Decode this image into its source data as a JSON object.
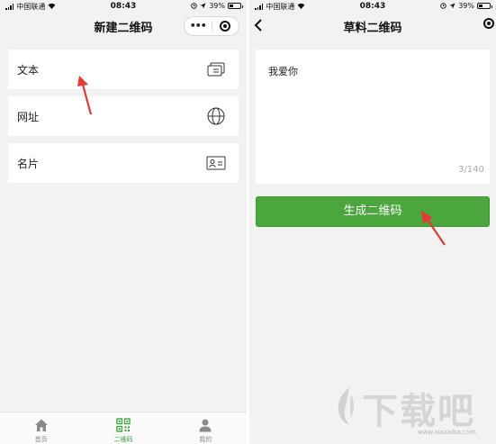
{
  "colors": {
    "accent_green": "#4ba63e",
    "arrow_red": "#e53935",
    "background": "#f2f2f2"
  },
  "left_screen": {
    "status_bar": {
      "carrier": "中国联通",
      "time": "08:43",
      "battery": "39%",
      "battery_level": 0.39
    },
    "nav": {
      "title": "新建二维码",
      "menu_icon": "more-dots-icon",
      "close_icon": "target-icon"
    },
    "items": [
      {
        "label": "文本",
        "icon": "text-cards-icon"
      },
      {
        "label": "网址",
        "icon": "globe-icon"
      },
      {
        "label": "名片",
        "icon": "id-card-icon"
      }
    ],
    "tabbar": {
      "tabs": [
        {
          "label": "首页",
          "icon": "home-icon",
          "active": false
        },
        {
          "label": "二维码",
          "icon": "qrcode-icon",
          "active": true
        },
        {
          "label": "我的",
          "icon": "person-icon",
          "active": false
        }
      ]
    }
  },
  "right_screen": {
    "status_bar": {
      "carrier": "中国联通",
      "time": "08:43",
      "battery": "39%",
      "battery_level": 0.39
    },
    "nav": {
      "title": "草料二维码",
      "back_icon": "chevron-left-icon"
    },
    "editor": {
      "content": "我爱你",
      "counter": "3/140"
    },
    "generate_button": "生成二维码"
  },
  "watermark": {
    "text": "下载吧",
    "url": "www.xiazaiba.com"
  }
}
